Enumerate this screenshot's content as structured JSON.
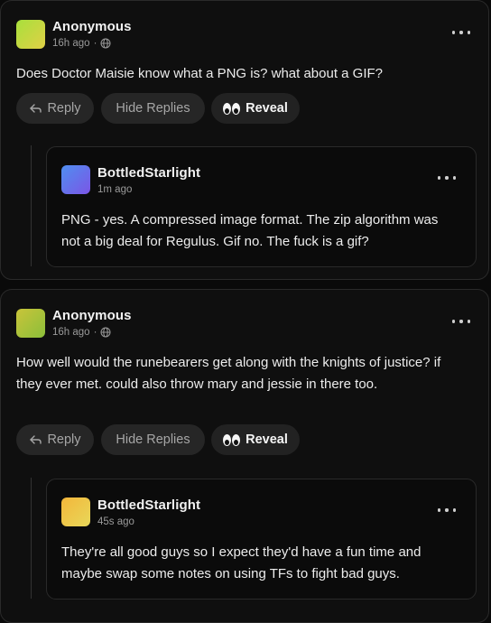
{
  "comments": [
    {
      "author": "Anonymous",
      "time": "16h ago",
      "separator": "·",
      "body": "Does Doctor Maisie know what a PNG is? what about a GIF?",
      "avatar_colors": [
        "#a8e03c",
        "#e0d046"
      ],
      "actions": {
        "reply": "Reply",
        "hide": "Hide Replies",
        "reveal": "Reveal"
      },
      "reply": {
        "author": "BottledStarlight",
        "time": "1m ago",
        "body": "PNG - yes. A compressed image format. The zip algorithm was not a big deal for Regulus. Gif no. The fuck is a gif?",
        "avatar_colors": [
          "#4f8ff0",
          "#7b55e6"
        ]
      }
    },
    {
      "author": "Anonymous",
      "time": "16h ago",
      "separator": "·",
      "body": "How well would the runebearers get along with the knights of justice? if they ever met. could also throw mary and jessie in there too.",
      "avatar_colors": [
        "#c9c43a",
        "#8bbf3a"
      ],
      "actions": {
        "reply": "Reply",
        "hide": "Hide Replies",
        "reveal": "Reveal"
      },
      "reply": {
        "author": "BottledStarlight",
        "time": "45s ago",
        "body": "They're all good guys so I expect they'd have a fun time and maybe swap some notes on using TFs to fight bad guys.",
        "avatar_colors": [
          "#f3b63a",
          "#e8d85a"
        ]
      }
    }
  ],
  "icons": {
    "more": "more-horizontal-icon",
    "globe": "globe-icon",
    "reply": "reply-arrow-icon",
    "reveal": "eyes-icon"
  }
}
